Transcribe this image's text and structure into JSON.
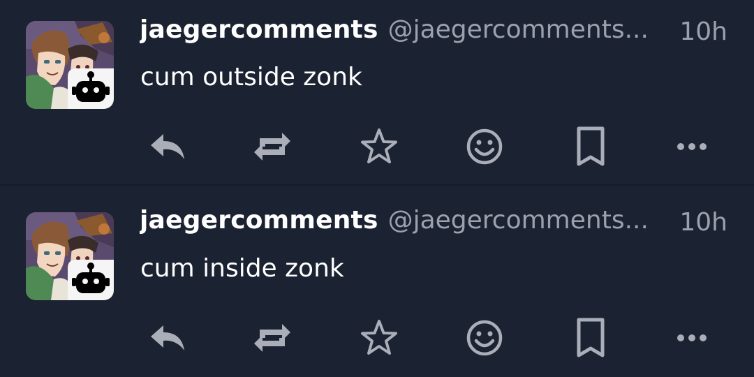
{
  "posts": [
    {
      "display_name": "jaegercomments",
      "handle": "@jaegercomments...",
      "time": "10h",
      "text": "cum outside zonk",
      "avatar_icon": "anime-avatar",
      "badge_icon": "bot-icon"
    },
    {
      "display_name": "jaegercomments",
      "handle": "@jaegercomments...",
      "time": "10h",
      "text": "cum inside zonk",
      "avatar_icon": "anime-avatar",
      "badge_icon": "bot-icon"
    }
  ],
  "actions": [
    "reply-icon",
    "boost-icon",
    "star-icon",
    "emoji-react-icon",
    "bookmark-icon",
    "more-icon"
  ],
  "colors": {
    "background": "#1b2232",
    "divider": "#151b28",
    "text_primary": "#ffffff",
    "text_secondary": "#9ba1ad",
    "icon": "#a9aeb8"
  }
}
